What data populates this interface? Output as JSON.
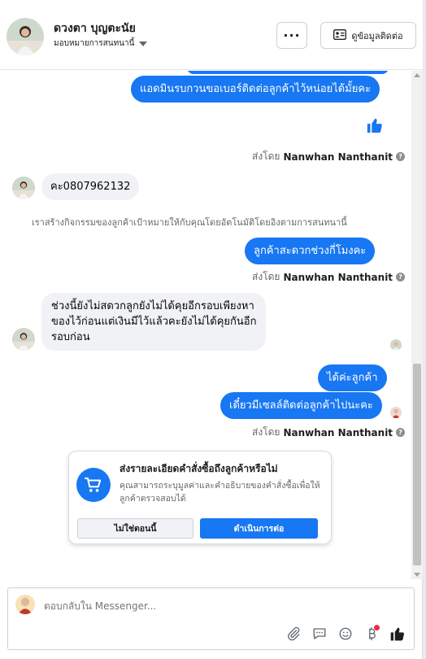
{
  "header": {
    "contact_name": "ดวงตา บุญตะนัย",
    "assign_label": "มอบหมายการสนทนานี้",
    "more_label": "···",
    "contact_info_label": "ดูข้อมูลติดต่อ"
  },
  "messages": {
    "out_1": "แอดมินรบกวนขอเบอร์ติดต่อลูกค้าไว้หน่อยได้มั้ยคะ",
    "sent_by_prefix": "ส่งโดย",
    "agent_name": "Nanwhan Nanthanit",
    "in_1": "คะ0807962132",
    "system_note": "เราสร้างกิจกรรมของลูกค้าเป้าหมายให้กับคุณโดยอัตโนมัติโดยอิงตามการสนทนานี้",
    "out_2": "ลูกค้าสะดวกช่วงกี่โมงคะ",
    "in_2": [
      "ช่วงนี้ยังไม่สดวกลูกยังไม่ได้คุยอีกรอบเพียงหา",
      "ของไว้ก่อนแต่เงินมีไว้แล้วคะยังไม่ได้คุยกันอีก",
      "รอบก่อน"
    ],
    "out_3": "ได้ค่ะลูกค้า",
    "out_4": "เดี๋ยวมีเซลล์ติดต่อลูกค้าไปนะคะ"
  },
  "card": {
    "title": "ส่งรายละเอียดคำสั่งซื้อถึงลูกค้าหรือไม่",
    "desc": "คุณสามารถระบุมูลค่าและคำอธิบายของคำสั่งซื้อเพื่อให้ลูกค้าตรวจสอบได้",
    "skip_label": "ไม่ใช่ตอนนี้",
    "continue_label": "ดำเนินการต่อ"
  },
  "composer": {
    "placeholder": "ตอบกลับใน Messenger..."
  },
  "colors": {
    "accent": "#1877f2",
    "incoming_bubble": "#f0f2f5",
    "notification_dot": "#f02849"
  },
  "icons": [
    "more-icon",
    "contact-card-icon",
    "like-icon",
    "help-icon",
    "cart-icon",
    "attachment-icon",
    "quick-reply-icon",
    "emoji-icon",
    "baht-icon",
    "thumbs-up-icon"
  ]
}
